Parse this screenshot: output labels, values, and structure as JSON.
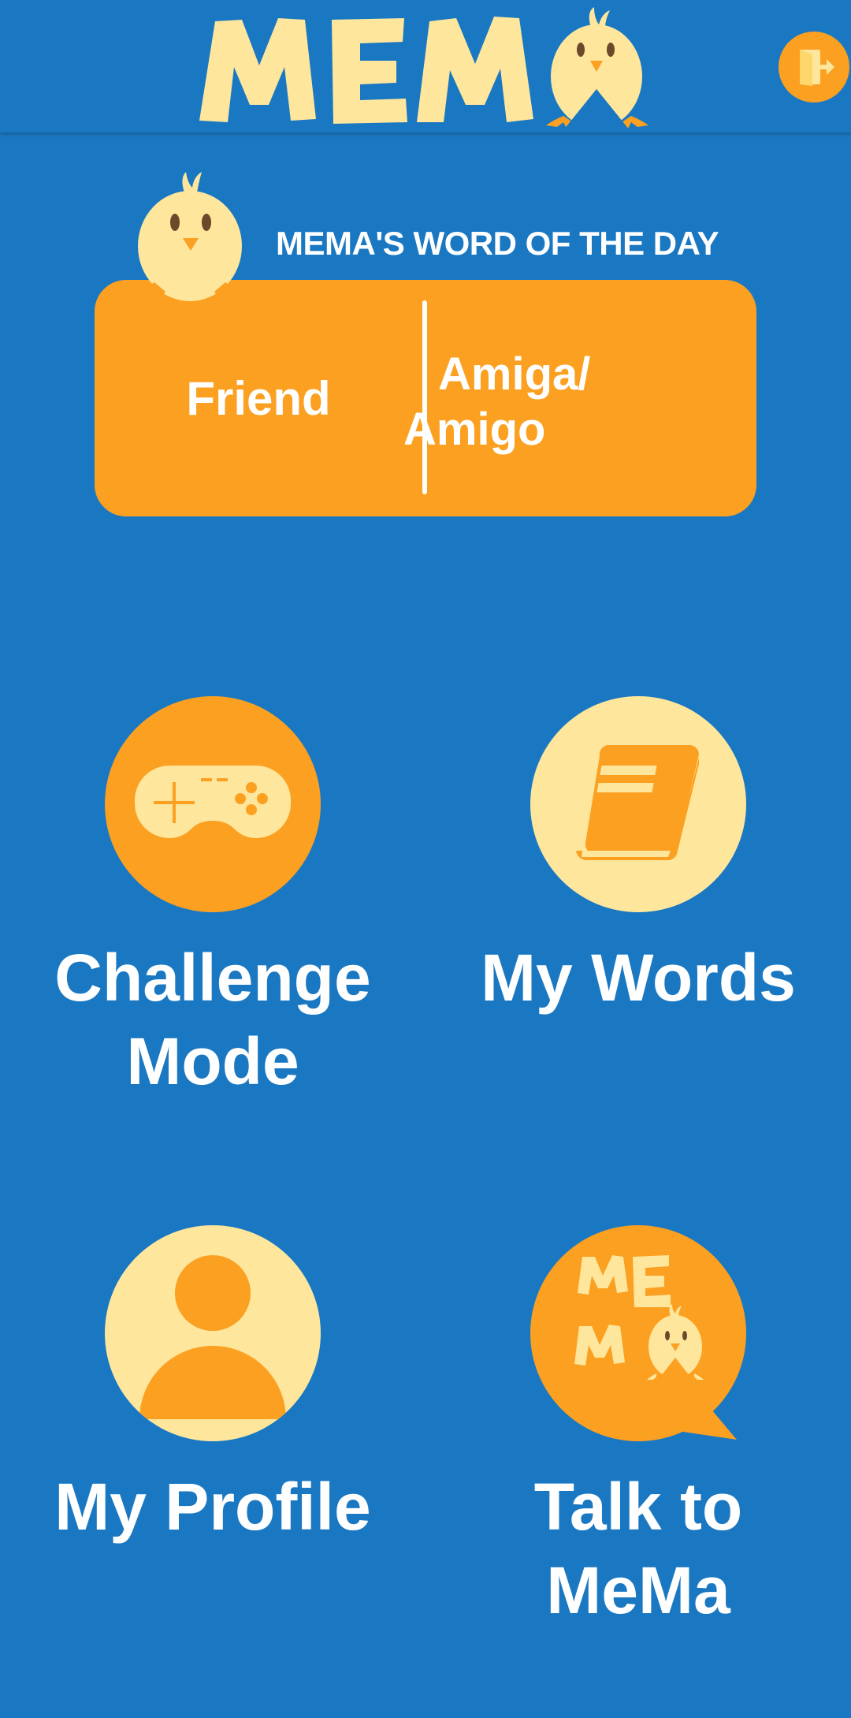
{
  "app": {
    "logo_text": "MEMA"
  },
  "header": {
    "logout_icon": "logout-door-icon"
  },
  "word_of_day": {
    "title": "MEMA'S WORD OF THE DAY",
    "english": "Friend",
    "spanish_line1": "Amiga/",
    "spanish_line2": "Amigo"
  },
  "menu": {
    "challenge": {
      "label_line1": "Challenge",
      "label_line2": "Mode",
      "icon": "gamepad-icon"
    },
    "my_words": {
      "label_line1": "My Words",
      "icon": "book-icon"
    },
    "my_profile": {
      "label_line1": "My Profile",
      "icon": "profile-icon"
    },
    "talk": {
      "label_line1": "Talk to",
      "label_line2": "MeMa",
      "icon": "mema-chat-icon",
      "icon_text_top": "ME",
      "icon_text_bottom": "MA"
    }
  },
  "colors": {
    "background": "#1a78c2",
    "accent_orange": "#fba021",
    "accent_cream": "#fee69c",
    "text": "#ffffff"
  }
}
